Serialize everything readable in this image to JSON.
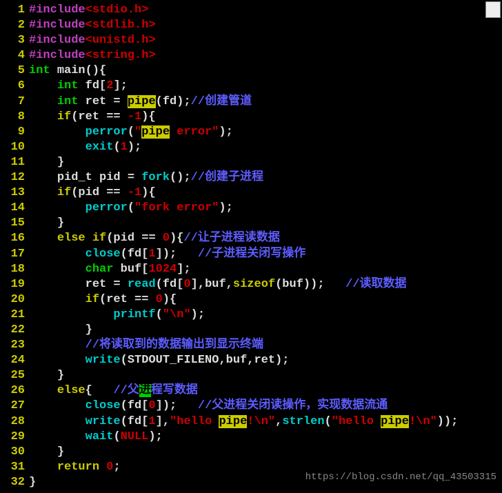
{
  "watermark": "https://blog.csdn.net/qq_43503315",
  "lines": {
    "1": {
      "include": "#include",
      "lt": "<",
      "hdr": "stdio.h",
      "gt": ">"
    },
    "2": {
      "include": "#include",
      "lt": "<",
      "hdr": "stdlib.h",
      "gt": ">"
    },
    "3": {
      "include": "#include",
      "lt": "<",
      "hdr": "unistd.h",
      "gt": ">"
    },
    "4": {
      "include": "#include",
      "lt": "<",
      "hdr": "string.h",
      "gt": ">"
    },
    "5": {
      "kw": "int",
      "sp": " ",
      "fn": "main",
      "rest": "(){"
    },
    "6": {
      "pre": "    ",
      "kw": "int",
      "mid": " fd[",
      "num": "2",
      "end": "];"
    },
    "7": {
      "pre": "    ",
      "kw": "int",
      "a": " ret = ",
      "hl": "pipe",
      "b": "(fd);",
      "cmt": "//创建管道"
    },
    "8": {
      "pre": "    ",
      "kw": "if",
      "a": "(ret == ",
      "num": "-1",
      "b": "){"
    },
    "9": {
      "pre": "        ",
      "fn": "perror",
      "a": "(",
      "q1": "\"",
      "hl": "pipe",
      "str": " error",
      "q2": "\"",
      "b": ");"
    },
    "10": {
      "pre": "        ",
      "fn": "exit",
      "a": "(",
      "num": "1",
      "b": ");"
    },
    "11": {
      "pre": "    ",
      "b": "}"
    },
    "12": {
      "pre": "    ",
      "a": "pid_t pid = ",
      "fn": "fork",
      "b": "();",
      "cmt": "//创建子进程"
    },
    "13": {
      "pre": "    ",
      "kw": "if",
      "a": "(pid == ",
      "num": "-1",
      "b": "){"
    },
    "14": {
      "pre": "        ",
      "fn": "perror",
      "a": "(",
      "str": "\"fork error\"",
      "b": ");"
    },
    "15": {
      "pre": "    ",
      "b": "}"
    },
    "16": {
      "pre": "    ",
      "kw": "else if",
      "a": "(pid == ",
      "num": "0",
      "b": "){",
      "cmt": "//让子进程读数据"
    },
    "17": {
      "pre": "        ",
      "fn": "close",
      "a": "(fd[",
      "num": "1",
      "b": "]);   ",
      "cmt": "//子进程关闭写操作"
    },
    "18": {
      "pre": "        ",
      "kw": "char",
      "a": " buf[",
      "num": "1024",
      "b": "];"
    },
    "19": {
      "pre": "        ",
      "a": "ret = ",
      "fn": "read",
      "b": "(fd[",
      "num": "0",
      "c": "],buf,",
      "kw2": "sizeof",
      "d": "(buf));   ",
      "cmt": "//读取数据"
    },
    "20": {
      "pre": "        ",
      "kw": "if",
      "a": "(ret == ",
      "num": "0",
      "b": "){"
    },
    "21": {
      "pre": "            ",
      "fn": "printf",
      "a": "(",
      "str": "\"\\n\"",
      "b": ");"
    },
    "22": {
      "pre": "        ",
      "b": "}"
    },
    "23": {
      "pre": "        ",
      "cmt": "//将读取到的数据输出到显示终端"
    },
    "24": {
      "pre": "        ",
      "fn": "write",
      "a": "(STDOUT_FILENO,buf,ret);"
    },
    "25": {
      "pre": "    ",
      "b": "}"
    },
    "26": {
      "pre": "    ",
      "kw": "else",
      "a": "{   ",
      "cmt1": "//父",
      "hlg": "进",
      "cmt2": "程写数据"
    },
    "27": {
      "pre": "        ",
      "fn": "close",
      "a": "(fd[",
      "num": "0",
      "b": "]);   ",
      "cmt": "//父进程关闭读操作，实现数据流通"
    },
    "28": {
      "pre": "        ",
      "fn": "write",
      "a": "(fd[",
      "num": "1",
      "b": "],",
      "q1": "\"",
      "s1": "hello ",
      "hl1": "pipe",
      "s2": "!\\n",
      "q2": "\"",
      "c": ",",
      "fn2": "strlen",
      "d": "(",
      "q3": "\"",
      "s3": "hello ",
      "hl2": "pipe",
      "s4": "!\\n",
      "q4": "\"",
      "e": "));"
    },
    "29": {
      "pre": "        ",
      "fn": "wait",
      "a": "(",
      "num": "NULL",
      "b": ");"
    },
    "30": {
      "pre": "    ",
      "b": "}"
    },
    "31": {
      "pre": "    ",
      "kw": "return",
      "a": " ",
      "num": "0",
      "b": ";"
    },
    "32": {
      "b": "}"
    }
  },
  "ln": {
    "1": "1",
    "2": "2",
    "3": "3",
    "4": "4",
    "5": "5",
    "6": "6",
    "7": "7",
    "8": "8",
    "9": "9",
    "10": "10",
    "11": "11",
    "12": "12",
    "13": "13",
    "14": "14",
    "15": "15",
    "16": "16",
    "17": "17",
    "18": "18",
    "19": "19",
    "20": "20",
    "21": "21",
    "22": "22",
    "23": "23",
    "24": "24",
    "25": "25",
    "26": "26",
    "27": "27",
    "28": "28",
    "29": "29",
    "30": "30",
    "31": "31",
    "32": "32"
  }
}
